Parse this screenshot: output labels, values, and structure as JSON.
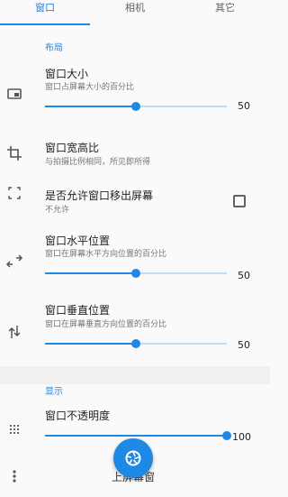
{
  "tabs": [
    {
      "label": "窗口",
      "active": true
    },
    {
      "label": "相机",
      "active": false
    },
    {
      "label": "其它",
      "active": false
    }
  ],
  "sections": {
    "layout_title": "布局",
    "display_title": "显示"
  },
  "items": {
    "window_size": {
      "title": "窗口大小",
      "subtitle": "窗口占屏幕大小的百分比",
      "value": 50,
      "value_label": "50",
      "icon": "window-icon"
    },
    "aspect_ratio": {
      "title": "窗口宽高比",
      "subtitle": "与拍摄比例相同，所见即所得",
      "icon": "crop-icon"
    },
    "allow_offscreen": {
      "title": "是否允许窗口移出屏幕",
      "subtitle": "不允许",
      "checked": false,
      "icon": "fullscreen-icon"
    },
    "h_position": {
      "title": "窗口水平位置",
      "subtitle": "窗口在屏幕水平方向位置的百分比",
      "value": 50,
      "value_label": "50",
      "icon": "swap-horizontal-icon"
    },
    "v_position": {
      "title": "窗口垂直位置",
      "subtitle": "窗口在屏幕垂直方向位置的百分比",
      "value": 50,
      "value_label": "50",
      "icon": "swap-vertical-icon"
    },
    "opacity": {
      "title": "窗口不透明度",
      "value": 100,
      "value_label": "100",
      "icon": "opacity-grid-icon"
    }
  },
  "bottom": {
    "fab_icon": "camera-shutter-icon",
    "clipped_label": "上屏幕窗",
    "more_icon": "more-vert-icon"
  },
  "colors": {
    "accent": "#1e88e5"
  }
}
